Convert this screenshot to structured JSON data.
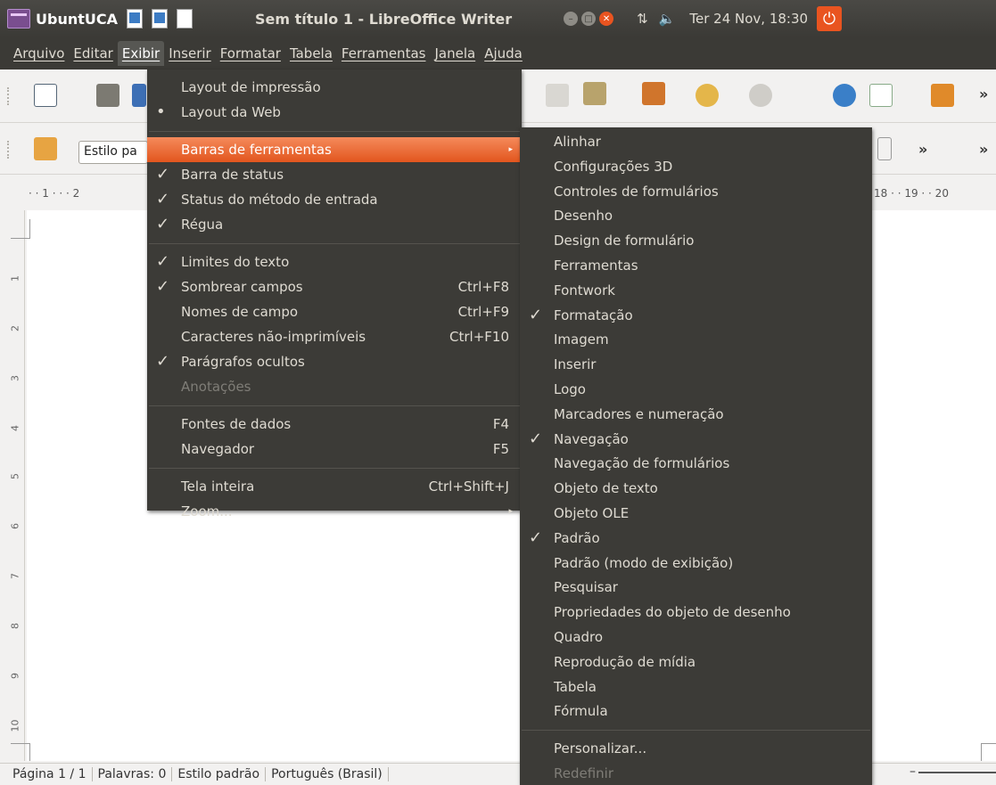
{
  "panel": {
    "app_name": "UbuntUCA",
    "window_title": "Sem título 1 - LibreOffice Writer",
    "clock": "Ter 24 Nov, 18:30"
  },
  "menubar": [
    "Arquivo",
    "Editar",
    "Exibir",
    "Inserir",
    "Formatar",
    "Tabela",
    "Ferramentas",
    "Janela",
    "Ajuda"
  ],
  "toolbar": {
    "style_value": "Estilo pa"
  },
  "ruler": {
    "left": "· · 1 · · · 2",
    "right": "18 · · 19 · · 20"
  },
  "vruler": [
    "1",
    "2",
    "3",
    "4",
    "5",
    "6",
    "7",
    "8",
    "9",
    "10"
  ],
  "view_menu": [
    {
      "label": "Layout de impressão"
    },
    {
      "label": "Layout da Web",
      "mark": "•"
    },
    {
      "sep": true
    },
    {
      "label": "Barras de ferramentas",
      "submenu": true,
      "hl": true
    },
    {
      "label": "Barra de status",
      "mark": "✓"
    },
    {
      "label": "Status do método de entrada",
      "mark": "✓"
    },
    {
      "label": "Régua",
      "mark": "✓"
    },
    {
      "sep": true
    },
    {
      "label": "Limites do texto",
      "mark": "✓"
    },
    {
      "label": "Sombrear campos",
      "mark": "✓",
      "shortcut": "Ctrl+F8"
    },
    {
      "label": "Nomes de campo",
      "shortcut": "Ctrl+F9"
    },
    {
      "label": "Caracteres não-imprimíveis",
      "shortcut": "Ctrl+F10"
    },
    {
      "label": "Parágrafos ocultos",
      "mark": "✓"
    },
    {
      "label": "Anotações",
      "disabled": true
    },
    {
      "sep": true
    },
    {
      "label": "Fontes de dados",
      "shortcut": "F4"
    },
    {
      "label": "Navegador",
      "shortcut": "F5"
    },
    {
      "sep": true
    },
    {
      "label": "Tela inteira",
      "shortcut": "Ctrl+Shift+J"
    },
    {
      "label": "Zoom...",
      "submenu": true
    }
  ],
  "toolbars_menu": [
    {
      "label": "Alinhar"
    },
    {
      "label": "Configurações 3D"
    },
    {
      "label": "Controles de formulários"
    },
    {
      "label": "Desenho"
    },
    {
      "label": "Design de formulário"
    },
    {
      "label": "Ferramentas"
    },
    {
      "label": "Fontwork"
    },
    {
      "label": "Formatação",
      "mark": "✓"
    },
    {
      "label": "Imagem"
    },
    {
      "label": "Inserir"
    },
    {
      "label": "Logo"
    },
    {
      "label": "Marcadores e numeração"
    },
    {
      "label": "Navegação",
      "mark": "✓"
    },
    {
      "label": "Navegação de formulários"
    },
    {
      "label": "Objeto de texto"
    },
    {
      "label": "Objeto OLE"
    },
    {
      "label": "Padrão",
      "mark": "✓"
    },
    {
      "label": "Padrão (modo de exibição)"
    },
    {
      "label": "Pesquisar"
    },
    {
      "label": "Propriedades do objeto de desenho"
    },
    {
      "label": "Quadro"
    },
    {
      "label": "Reprodução de mídia"
    },
    {
      "label": "Tabela"
    },
    {
      "label": "Fórmula"
    },
    {
      "sep": true
    },
    {
      "label": "Personalizar..."
    },
    {
      "label": "Redefinir",
      "disabled": true
    }
  ],
  "statusbar": [
    "Página 1 / 1",
    "Palavras: 0",
    "Estilo padrão",
    "Português (Brasil)"
  ],
  "colors": {
    "highlight": "#e2561e",
    "menu_bg": "#3c3b37",
    "panel_bg": "#3b3a36"
  }
}
